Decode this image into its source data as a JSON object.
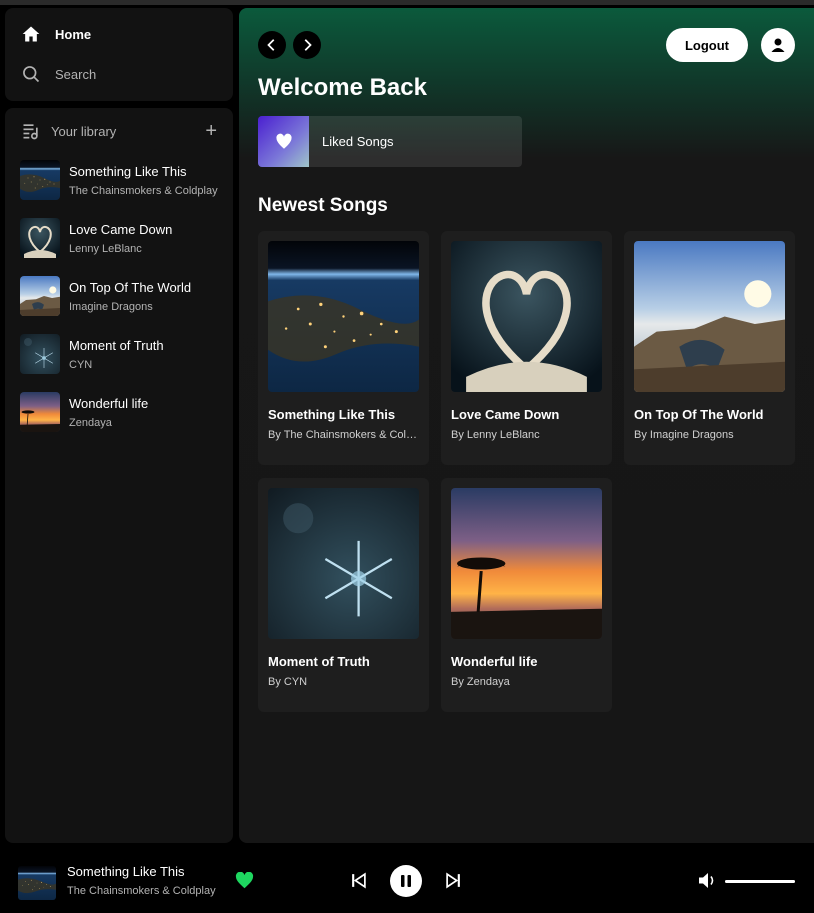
{
  "nav": {
    "home_label": "Home",
    "search_label": "Search"
  },
  "library": {
    "title": "Your library",
    "add_icon": "plus-icon",
    "items": [
      {
        "name": "Something Like This",
        "artist": "The Chainsmokers & Coldplay"
      },
      {
        "name": "Love Came Down",
        "artist": "Lenny LeBlanc"
      },
      {
        "name": "On Top Of The World",
        "artist": "Imagine Dragons"
      },
      {
        "name": "Moment of Truth",
        "artist": "CYN"
      },
      {
        "name": "Wonderful life",
        "artist": "Zendaya"
      }
    ]
  },
  "header": {
    "logout_label": "Logout",
    "welcome": "Welcome Back"
  },
  "liked": {
    "label": "Liked Songs"
  },
  "newest": {
    "title": "Newest Songs",
    "cards": [
      {
        "title": "Something Like This",
        "subtitle": "By The Chainsmokers & Coldplay"
      },
      {
        "title": "Love Came Down",
        "subtitle": "By Lenny LeBlanc"
      },
      {
        "title": "On Top Of The World",
        "subtitle": "By Imagine Dragons"
      },
      {
        "title": "Moment of Truth",
        "subtitle": "By CYN"
      },
      {
        "title": "Wonderful life",
        "subtitle": "By Zendaya"
      }
    ]
  },
  "player": {
    "title": "Something Like This",
    "artist": "The Chainsmokers & Coldplay",
    "volume_fraction": 1.0
  },
  "colors": {
    "accent_green": "#1ed760",
    "header_gradient_top": "#0b5a3c",
    "panel_bg": "#121212",
    "card_bg": "#1e1e1e"
  }
}
